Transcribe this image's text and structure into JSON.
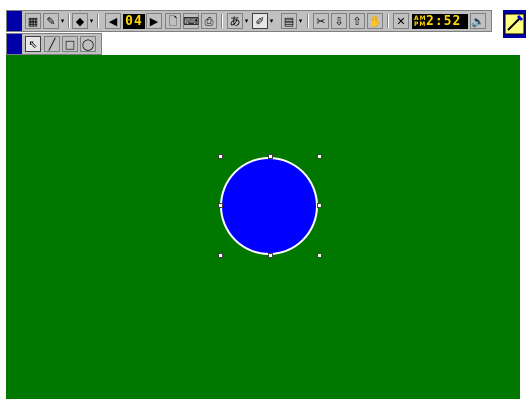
{
  "toolbar": {
    "page_counter": "04",
    "clock_ampm_top": "AM",
    "clock_ampm_bottom": "PM",
    "clock_time": "2:52",
    "icons": [
      "grid-icon",
      "pen-icon",
      "eraser-icon",
      "previous-page-icon",
      "next-page-icon",
      "new-page-icon",
      "keyboard-icon",
      "print-icon",
      "handwriting-icon",
      "color-icon",
      "insert-icon",
      "copy-icon",
      "import-icon",
      "export-icon",
      "hand-icon",
      "close-icon",
      "speaker-icon"
    ]
  },
  "draw_tools": [
    {
      "name": "select-tool",
      "glyph": "⇖",
      "active": true
    },
    {
      "name": "line-tool",
      "glyph": "╱",
      "active": false
    },
    {
      "name": "rectangle-tool",
      "glyph": "□",
      "active": false
    },
    {
      "name": "ellipse-tool",
      "glyph": "◯",
      "active": false
    }
  ],
  "colors": {
    "canvas": "#007800",
    "shape_fill": "#0000ff",
    "shape_outline": "#ffffff",
    "toolbar": "#c0c0c0",
    "grip": "#0000a8",
    "lcd_text": "#ffd700"
  },
  "canvas": {
    "selected_shape": {
      "type": "ellipse",
      "selected": true
    }
  }
}
